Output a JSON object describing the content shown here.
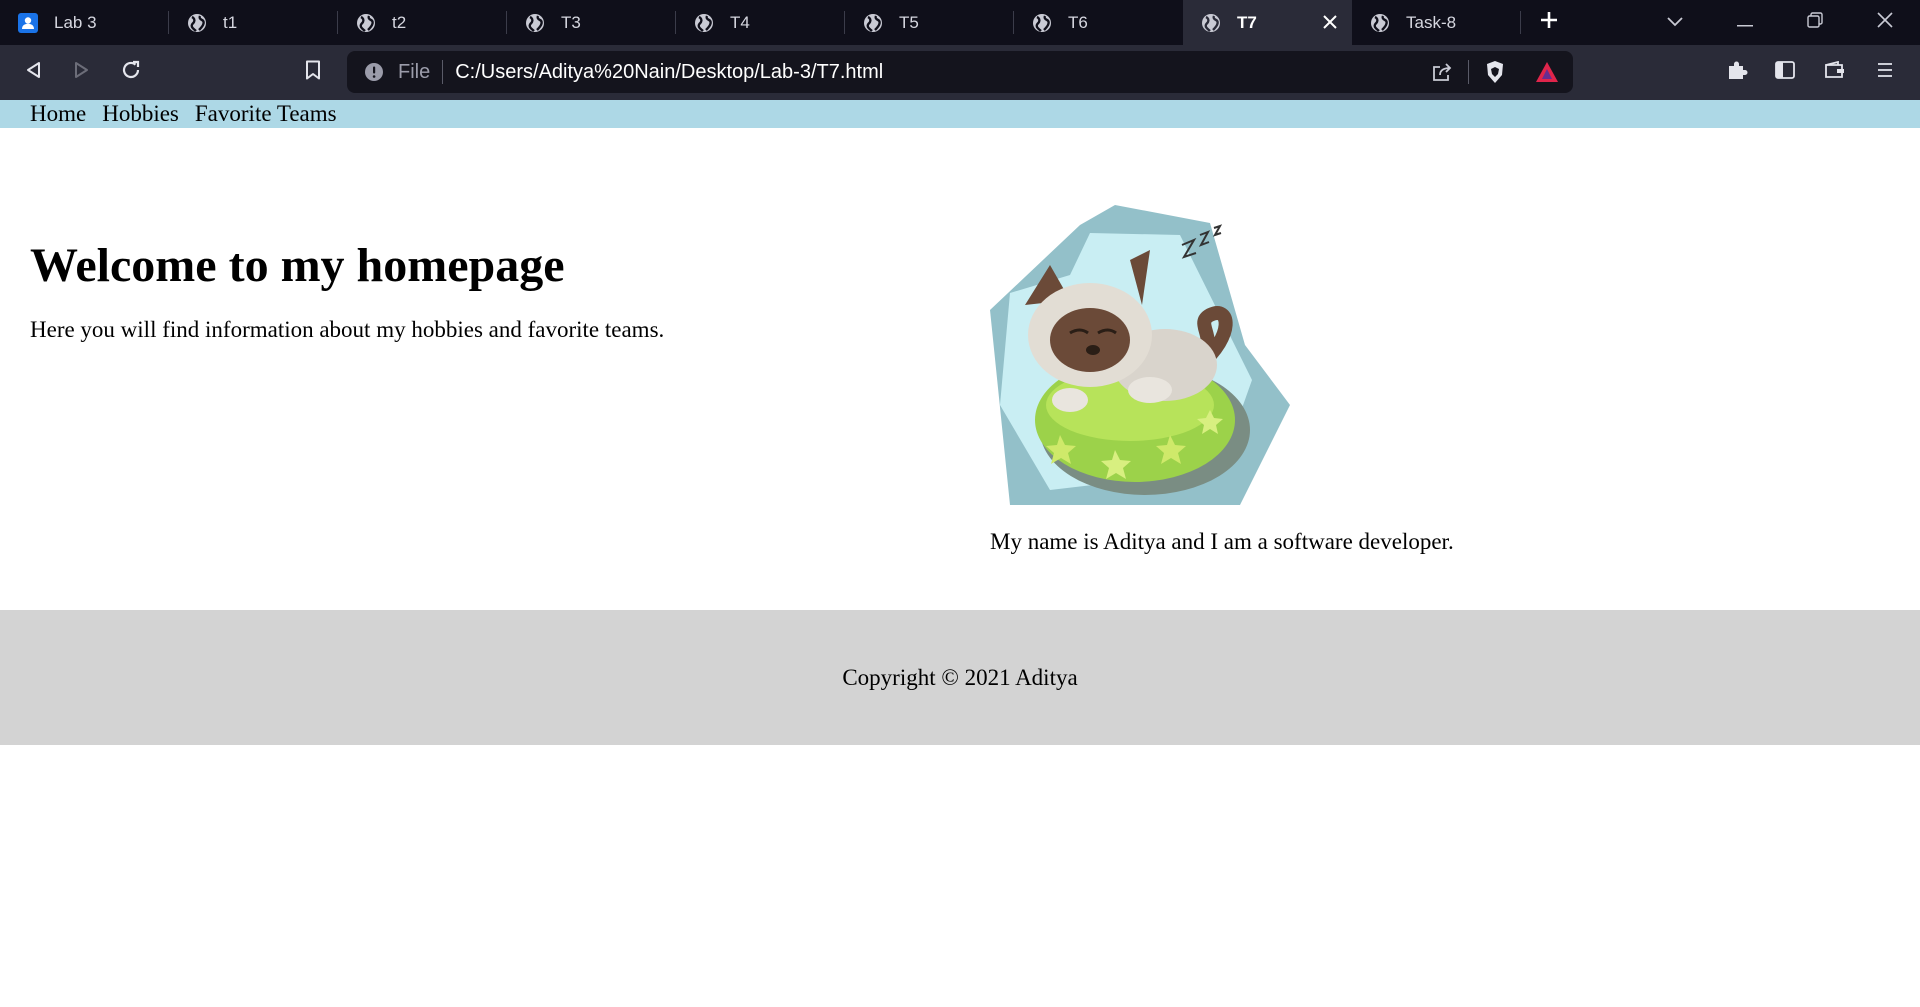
{
  "browser": {
    "tabs": [
      {
        "title": "Lab 3",
        "icon": "classroom-icon",
        "active": false
      },
      {
        "title": "t1",
        "icon": "globe-icon",
        "active": false
      },
      {
        "title": "t2",
        "icon": "globe-icon",
        "active": false
      },
      {
        "title": "T3",
        "icon": "globe-icon",
        "active": false
      },
      {
        "title": "T4",
        "icon": "globe-icon",
        "active": false
      },
      {
        "title": "T5",
        "icon": "globe-icon",
        "active": false
      },
      {
        "title": "T6",
        "icon": "globe-icon",
        "active": false
      },
      {
        "title": "T7",
        "icon": "globe-icon",
        "active": true
      },
      {
        "title": "Task-8",
        "icon": "globe-icon",
        "active": false
      }
    ],
    "address": {
      "scheme_label": "File",
      "url": "C:/Users/Aditya%20Nain/Desktop/Lab-3/T7.html"
    },
    "colors": {
      "tabbar_bg": "#0f0f1a",
      "toolbar_bg": "#2a2b38",
      "omnibox_bg": "#14141d"
    }
  },
  "page": {
    "nav": {
      "items": [
        {
          "label": "Home"
        },
        {
          "label": "Hobbies"
        },
        {
          "label": "Favorite Teams"
        }
      ],
      "bg_color": "#add8e6"
    },
    "hero": {
      "title": "Welcome to my homepage",
      "text": "Here you will find information about my hobbies and favorite teams."
    },
    "about": {
      "image_icon": "sleeping-cat-illustration",
      "text": "My name is Aditya and I am a software developer."
    },
    "footer": {
      "text": "Copyright © 2021 Aditya",
      "bg_color": "#d3d3d3"
    }
  }
}
